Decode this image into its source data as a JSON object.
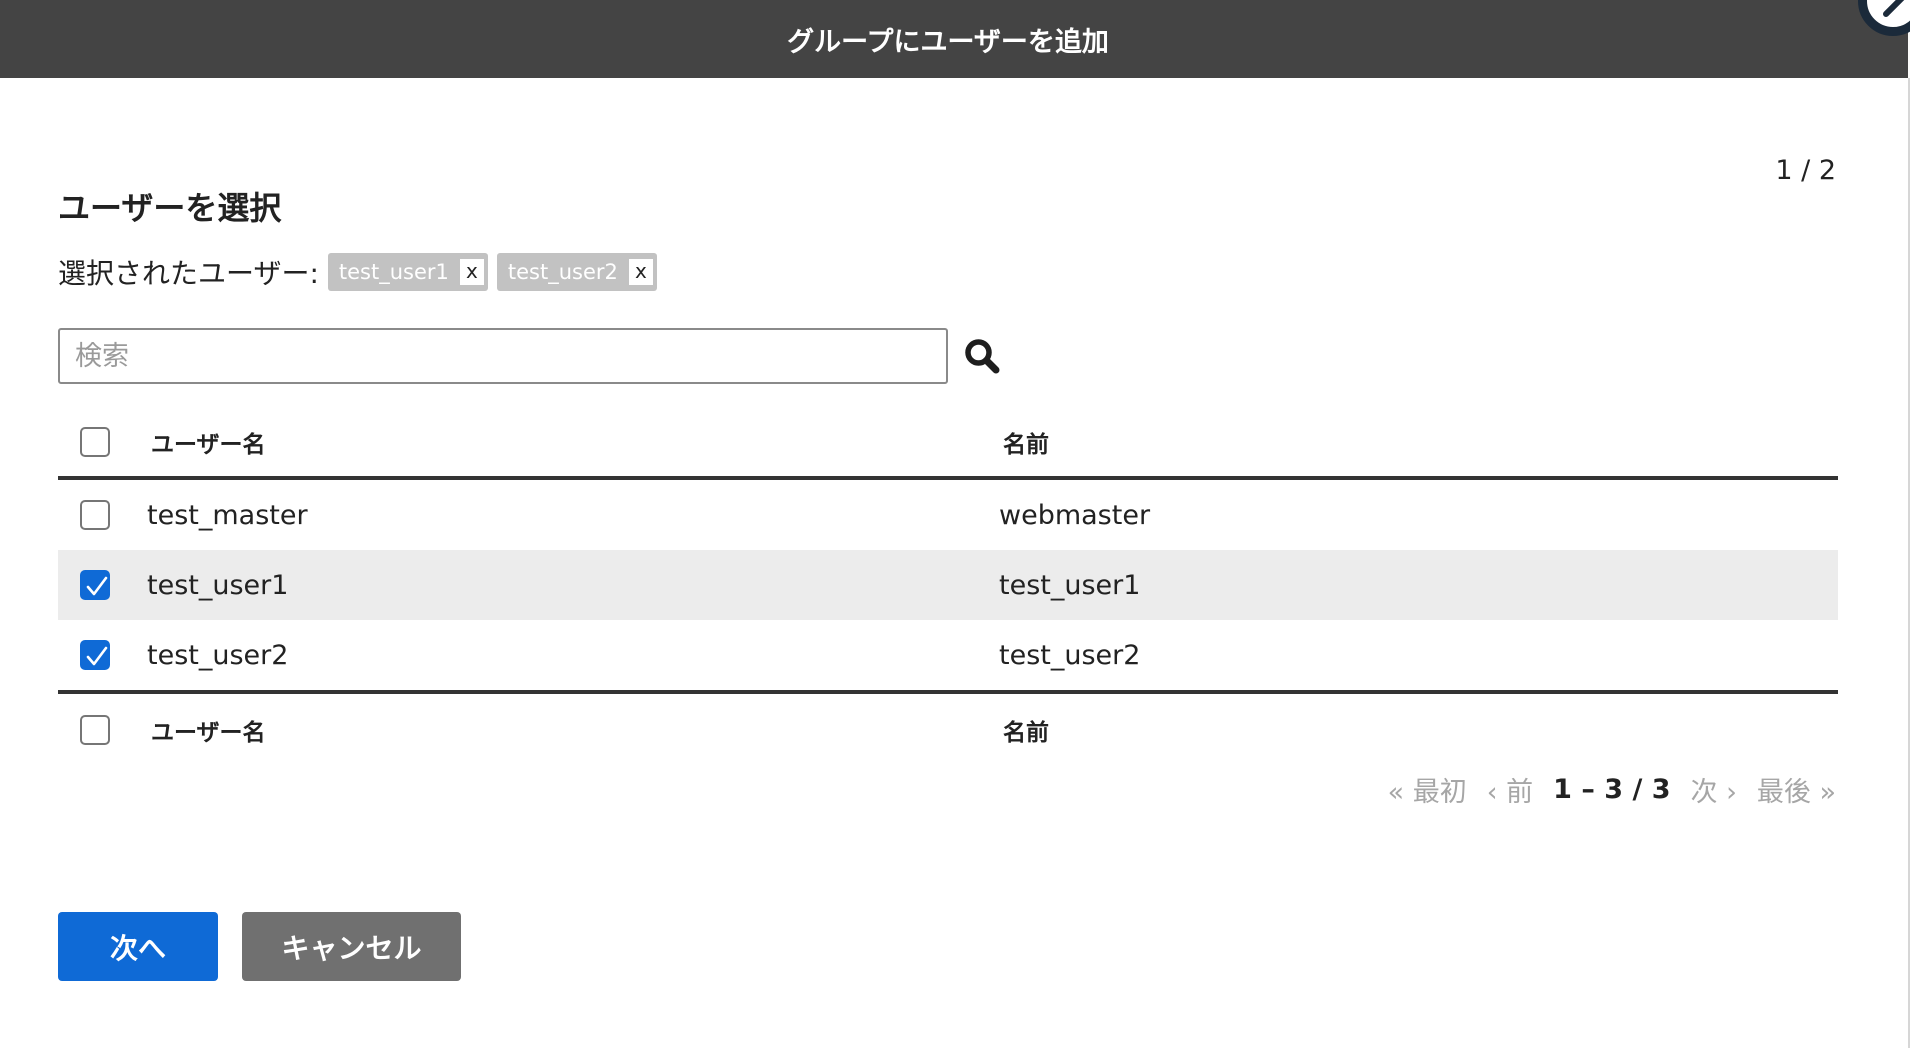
{
  "dialog": {
    "title": "グループにユーザーを追加",
    "step": "1 / 2"
  },
  "section": {
    "title": "ユーザーを選択"
  },
  "selected": {
    "label": "選択されたユーザー:",
    "chips": [
      {
        "label": "test_user1",
        "remove": "x"
      },
      {
        "label": "test_user2",
        "remove": "x"
      }
    ]
  },
  "search": {
    "placeholder": "検索",
    "value": "",
    "icon": "search-icon"
  },
  "table": {
    "columns": {
      "username": "ユーザー名",
      "name": "名前"
    },
    "rows": [
      {
        "username": "test_master",
        "name": "webmaster",
        "checked": false
      },
      {
        "username": "test_user1",
        "name": "test_user1",
        "checked": true
      },
      {
        "username": "test_user2",
        "name": "test_user2",
        "checked": true
      }
    ]
  },
  "pagination": {
    "first": "« 最初",
    "prev": "‹ 前",
    "status": "1 – 3 / 3",
    "next": "次 ›",
    "last": "最後 »"
  },
  "buttons": {
    "next": "次へ",
    "cancel": "キャンセル"
  },
  "colors": {
    "header_bg": "#444444",
    "primary": "#0f6ad6",
    "secondary_button": "#707070",
    "chip_bg": "#c2c2c2",
    "selected_row_bg": "#ececec"
  }
}
